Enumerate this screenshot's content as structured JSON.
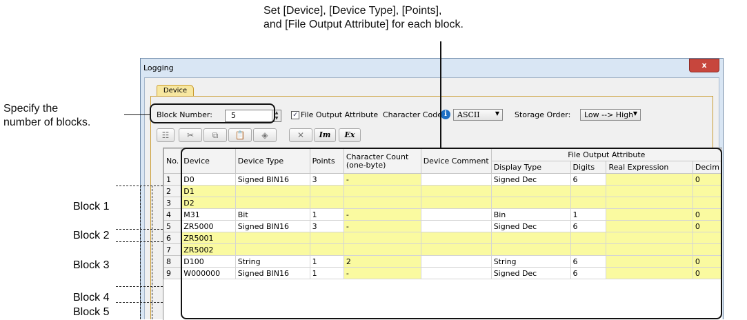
{
  "annotations": {
    "top_line1": "Set [Device], [Device Type], [Points],",
    "top_line2": "and [File Output Attribute] for each block.",
    "left_line1": "Specify the",
    "left_line2": "number of blocks.",
    "blocks": [
      "Block 1",
      "Block 2",
      "Block 3",
      "Block 4",
      "Block 5"
    ]
  },
  "window": {
    "title": "Logging",
    "close_glyph": "x",
    "tab": "Device",
    "block_number_label": "Block Number:",
    "block_number_value": "5",
    "file_output_label": "File Output Attribute",
    "file_output_checked": true,
    "character_code_label": "Character Code:",
    "character_code_value": "ASCII",
    "storage_order_label": "Storage Order:",
    "storage_order_value": "Low --> High"
  },
  "toolbar": {
    "icons": [
      "insert-row-icon",
      "cut-icon",
      "copy-icon",
      "paste-icon",
      "clear-icon",
      "delete-icon",
      "import-icon",
      "export-icon"
    ],
    "import_label": "Im",
    "export_label": "Ex"
  },
  "table": {
    "group_header": "File Output Attribute",
    "headers": [
      "No.",
      "Device",
      "Device Type",
      "Points",
      "Character Count (one-byte)",
      "Device Comment",
      "Display Type",
      "Digits",
      "Real Expression",
      "Decim"
    ],
    "rows": [
      {
        "no": "1",
        "device": "D0",
        "type": "Signed BIN16",
        "points": "3",
        "count": "-",
        "comment": "",
        "display": "Signed Dec",
        "digits": "6",
        "real": "",
        "decim": "0"
      },
      {
        "no": "2",
        "device": "D1",
        "type": "",
        "points": "",
        "count": "",
        "comment": "",
        "display": "",
        "digits": "",
        "real": "",
        "decim": ""
      },
      {
        "no": "3",
        "device": "D2",
        "type": "",
        "points": "",
        "count": "",
        "comment": "",
        "display": "",
        "digits": "",
        "real": "",
        "decim": ""
      },
      {
        "no": "4",
        "device": "M31",
        "type": "Bit",
        "points": "1",
        "count": "-",
        "comment": "",
        "display": "Bin",
        "digits": "1",
        "real": "",
        "decim": "0"
      },
      {
        "no": "5",
        "device": "ZR5000",
        "type": "Signed BIN16",
        "points": "3",
        "count": "-",
        "comment": "",
        "display": "Signed Dec",
        "digits": "6",
        "real": "",
        "decim": "0"
      },
      {
        "no": "6",
        "device": "ZR5001",
        "type": "",
        "points": "",
        "count": "",
        "comment": "",
        "display": "",
        "digits": "",
        "real": "",
        "decim": ""
      },
      {
        "no": "7",
        "device": "ZR5002",
        "type": "",
        "points": "",
        "count": "",
        "comment": "",
        "display": "",
        "digits": "",
        "real": "",
        "decim": ""
      },
      {
        "no": "8",
        "device": "D100",
        "type": "String",
        "points": "1",
        "count": "2",
        "comment": "",
        "display": "String",
        "digits": "6",
        "real": "",
        "decim": "0"
      },
      {
        "no": "9",
        "device": "W000000",
        "type": "Signed BIN16",
        "points": "1",
        "count": "-",
        "comment": "",
        "display": "Signed Dec",
        "digits": "6",
        "real": "",
        "decim": "0"
      }
    ]
  }
}
